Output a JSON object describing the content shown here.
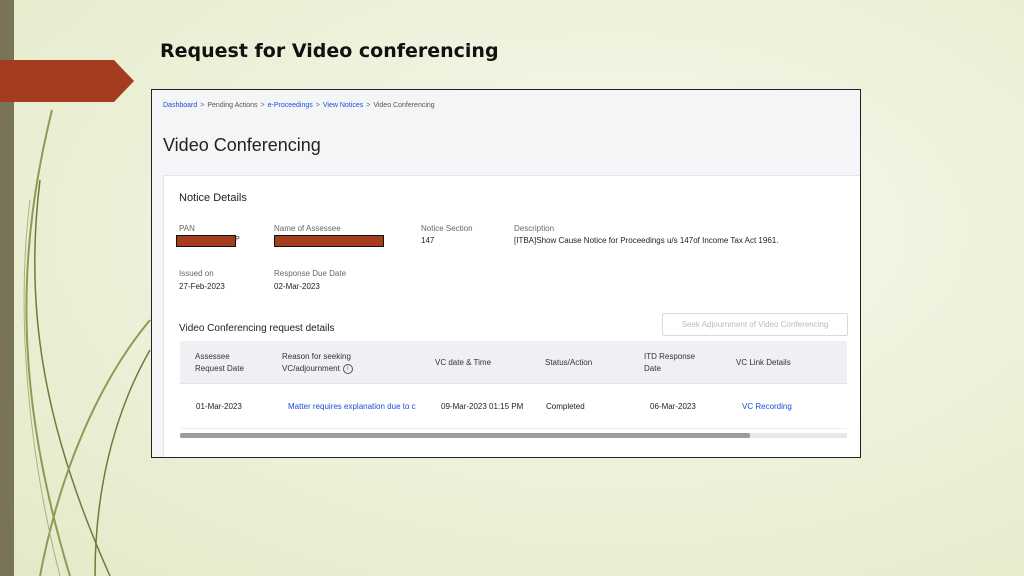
{
  "slide": {
    "title": "Request for Video conferencing",
    "accent_color": "#a53b1f"
  },
  "breadcrumb": [
    {
      "label": "Dashboard",
      "link": true
    },
    {
      "label": "Pending Actions",
      "link": false
    },
    {
      "label": "e-Proceedings",
      "link": true
    },
    {
      "label": "View Notices",
      "link": true
    },
    {
      "label": "Video Conferencing",
      "link": false
    }
  ],
  "breadcrumb_separator": ">",
  "page": {
    "heading": "Video Conferencing"
  },
  "notice": {
    "title": "Notice Details",
    "pan_label": "PAN",
    "pan_trailing": "P",
    "assessee_label": "Name of Assessee",
    "section_label": "Notice Section",
    "section_value": "147",
    "description_label": "Description",
    "description_value": "[ITBA]Show Cause Notice for Proceedings u/s 147of Income Tax Act 1961.",
    "issued_label": "Issued on",
    "issued_value": "27-Feb-2023",
    "due_label": "Response Due Date",
    "due_value": "02-Mar-2023"
  },
  "vc": {
    "title": "Video Conferencing request details",
    "seek_button": "Seek Adjournment of Video Conferencing",
    "columns": [
      "Assessee Request Date",
      "Reason for seeking VC/adjournment",
      "VC date & Time",
      "Status/Action",
      "ITD Response Date",
      "VC Link Details"
    ],
    "col_assessee_1": "Assessee",
    "col_assessee_2": "Request Date",
    "col_reason_1": "Reason for seeking",
    "col_reason_2": "VC/adjournment",
    "col_vc_date": "VC date & Time",
    "col_status": "Status/Action",
    "col_itd_1": "ITD Response",
    "col_itd_2": "Date",
    "col_link": "VC Link Details",
    "row": {
      "request_date": "01-Mar-2023",
      "reason": "Matter requires explanation due to c",
      "vc_datetime": "09-Mar-2023 01:15 PM",
      "status": "Completed",
      "itd_response_date": "06-Mar-2023",
      "vc_link": "VC Recording"
    },
    "horizontal_scroll_position": 0.0
  },
  "icons": {
    "info": "info-icon",
    "slide_arrow": "arrow-icon"
  }
}
